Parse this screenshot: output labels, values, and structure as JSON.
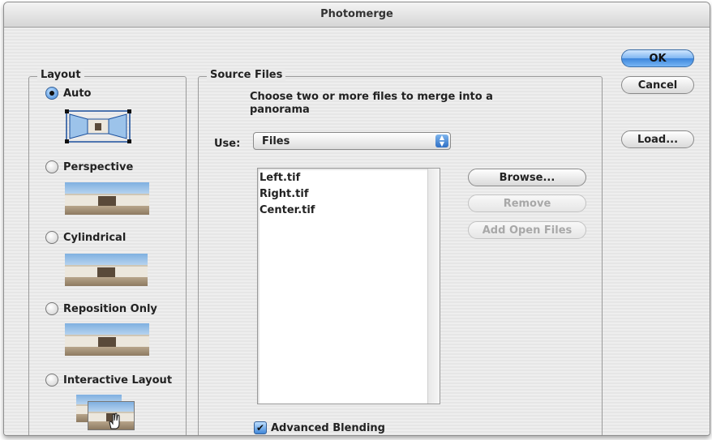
{
  "window": {
    "title": "Photomerge"
  },
  "layout": {
    "legend": "Layout",
    "options": [
      {
        "label": "Auto",
        "checked": true
      },
      {
        "label": "Perspective",
        "checked": false
      },
      {
        "label": "Cylindrical",
        "checked": false
      },
      {
        "label": "Reposition Only",
        "checked": false
      },
      {
        "label": "Interactive Layout",
        "checked": false
      }
    ]
  },
  "source": {
    "legend": "Source Files",
    "instructions": "Choose two or more files to merge into a panorama",
    "use_label": "Use:",
    "use_value": "Files",
    "files": [
      "Left.tif",
      "Right.tif",
      "Center.tif"
    ],
    "browse_label": "Browse...",
    "remove_label": "Remove",
    "add_open_label": "Add Open Files",
    "advanced_blending_label": "Advanced Blending",
    "advanced_blending_checked": true
  },
  "actions": {
    "ok_label": "OK",
    "cancel_label": "Cancel",
    "load_label": "Load..."
  }
}
